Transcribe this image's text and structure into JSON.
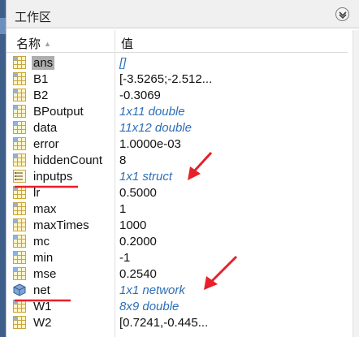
{
  "panel": {
    "title": "工作区"
  },
  "table": {
    "name_header": "名称",
    "value_header": "值",
    "sort_glyph": "▲"
  },
  "variables": [
    {
      "name": "ans",
      "value": "[]",
      "type": "matrix",
      "meta": true,
      "selected": true
    },
    {
      "name": "B1",
      "value": "[-3.5265;-2.512...",
      "type": "matrix",
      "meta": false
    },
    {
      "name": "B2",
      "value": "-0.3069",
      "type": "matrix",
      "meta": false
    },
    {
      "name": "BPoutput",
      "value": "1x11 double",
      "type": "matrix",
      "meta": true
    },
    {
      "name": "data",
      "value": "11x12 double",
      "type": "matrix",
      "meta": true
    },
    {
      "name": "error",
      "value": "1.0000e-03",
      "type": "matrix",
      "meta": false
    },
    {
      "name": "hiddenCount",
      "value": "8",
      "type": "matrix",
      "meta": false
    },
    {
      "name": "inputps",
      "value": "1x1 struct",
      "type": "struct",
      "meta": true
    },
    {
      "name": "lr",
      "value": "0.5000",
      "type": "matrix",
      "meta": false
    },
    {
      "name": "max",
      "value": "1",
      "type": "matrix",
      "meta": false
    },
    {
      "name": "maxTimes",
      "value": "1000",
      "type": "matrix",
      "meta": false
    },
    {
      "name": "mc",
      "value": "0.2000",
      "type": "matrix",
      "meta": false
    },
    {
      "name": "min",
      "value": "-1",
      "type": "matrix",
      "meta": false
    },
    {
      "name": "mse",
      "value": "0.2540",
      "type": "matrix",
      "meta": false
    },
    {
      "name": "net",
      "value": "1x1 network",
      "type": "object",
      "meta": true
    },
    {
      "name": "W1",
      "value": "8x9 double",
      "type": "matrix",
      "meta": true
    },
    {
      "name": "W2",
      "value": "[0.7241,-0.445...",
      "type": "matrix",
      "meta": false
    }
  ],
  "annotations": {
    "color": "#e8202a"
  }
}
